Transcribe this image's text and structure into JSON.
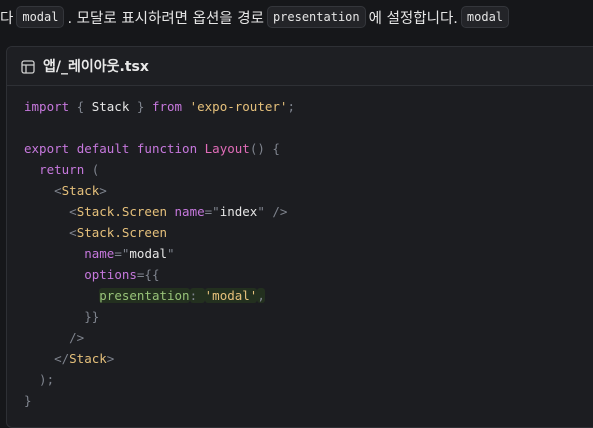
{
  "intro": {
    "prefix": "다",
    "chip1": "modal",
    "middle": ". 모달로 표시하려면 옵션을 경로",
    "chip2": "presentation",
    "suffix": "에 설정합니다.",
    "chip3": "modal"
  },
  "codeblock": {
    "filename": "앱/_레이아웃.tsx",
    "icon": "layout-file-icon",
    "lines": [
      [
        {
          "t": "import",
          "c": "kw"
        },
        {
          "t": " { ",
          "c": "pun"
        },
        {
          "t": "Stack",
          "c": "idn"
        },
        {
          "t": " } ",
          "c": "pun"
        },
        {
          "t": "from",
          "c": "kw"
        },
        {
          "t": " ",
          "c": "pun"
        },
        {
          "t": "'expo-router'",
          "c": "str"
        },
        {
          "t": ";",
          "c": "pun"
        }
      ],
      [],
      [
        {
          "t": "export",
          "c": "kw"
        },
        {
          "t": " ",
          "c": "pun"
        },
        {
          "t": "default",
          "c": "kw"
        },
        {
          "t": " ",
          "c": "pun"
        },
        {
          "t": "function",
          "c": "kw"
        },
        {
          "t": " ",
          "c": "pun"
        },
        {
          "t": "Layout",
          "c": "fn"
        },
        {
          "t": "() {",
          "c": "pun"
        }
      ],
      [
        {
          "t": "  ",
          "c": "pun"
        },
        {
          "t": "return",
          "c": "kw"
        },
        {
          "t": " (",
          "c": "pun"
        }
      ],
      [
        {
          "t": "    <",
          "c": "pun"
        },
        {
          "t": "Stack",
          "c": "str"
        },
        {
          "t": ">",
          "c": "pun"
        }
      ],
      [
        {
          "t": "      <",
          "c": "pun"
        },
        {
          "t": "Stack.Screen",
          "c": "str"
        },
        {
          "t": " ",
          "c": "pun"
        },
        {
          "t": "name",
          "c": "kw"
        },
        {
          "t": "=\"",
          "c": "pun"
        },
        {
          "t": "index",
          "c": "idn"
        },
        {
          "t": "\" />",
          "c": "pun"
        }
      ],
      [
        {
          "t": "      <",
          "c": "pun"
        },
        {
          "t": "Stack.Screen",
          "c": "str"
        }
      ],
      [
        {
          "t": "        ",
          "c": "pun"
        },
        {
          "t": "name",
          "c": "kw"
        },
        {
          "t": "=\"",
          "c": "pun"
        },
        {
          "t": "modal",
          "c": "idn"
        },
        {
          "t": "\"",
          "c": "pun"
        }
      ],
      [
        {
          "t": "        ",
          "c": "pun"
        },
        {
          "t": "options",
          "c": "kw"
        },
        {
          "t": "={{",
          "c": "pun"
        }
      ],
      [
        {
          "t": "          ",
          "c": "pun"
        },
        {
          "t": "presentation",
          "c": "green",
          "hl": true
        },
        {
          "t": ": ",
          "c": "pun",
          "hl": true
        },
        {
          "t": "'modal'",
          "c": "str",
          "hl": true
        },
        {
          "t": ",",
          "c": "pun",
          "hl": true
        }
      ],
      [
        {
          "t": "        }}",
          "c": "pun"
        }
      ],
      [
        {
          "t": "      />",
          "c": "pun"
        }
      ],
      [
        {
          "t": "    </",
          "c": "pun"
        },
        {
          "t": "Stack",
          "c": "str"
        },
        {
          "t": ">",
          "c": "pun"
        }
      ],
      [
        {
          "t": "  );",
          "c": "pun"
        }
      ],
      [
        {
          "t": "}",
          "c": "pun"
        }
      ]
    ]
  }
}
